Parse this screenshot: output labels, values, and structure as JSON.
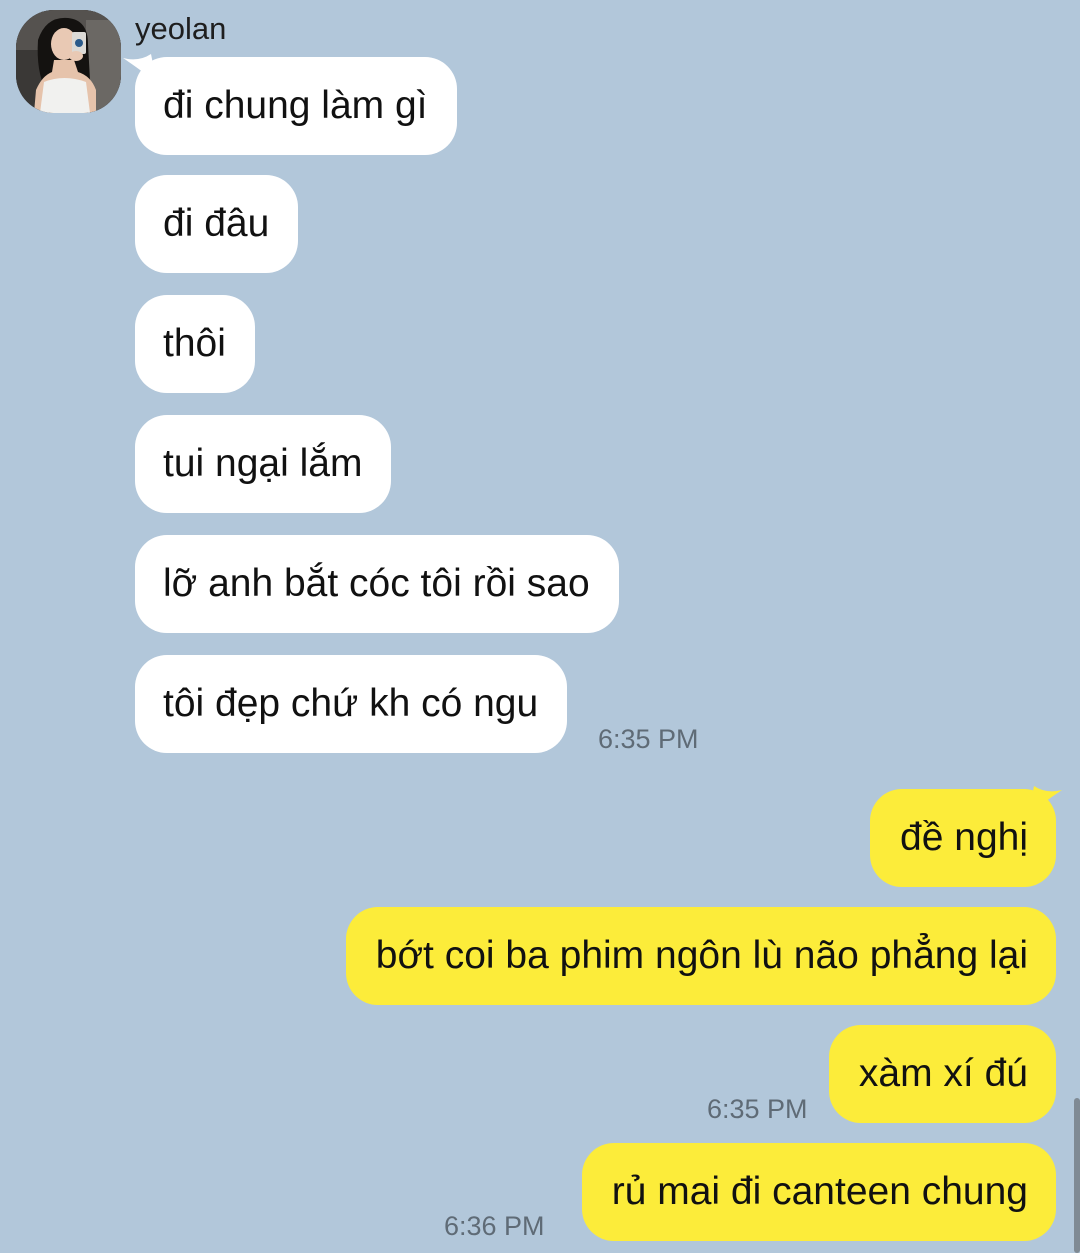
{
  "contact": {
    "name": "yeolan"
  },
  "incoming": [
    "đi chung làm gì",
    "đi đâu",
    "thôi",
    "tui ngại lắm",
    "lỡ anh bắt cóc tôi rồi sao",
    "tôi đẹp chứ kh có ngu"
  ],
  "incoming_time": "6:35 PM",
  "outgoing": [
    "đề nghị",
    "bớt coi ba phim ngôn lù não phẳng lại",
    "xàm xí đú",
    "rủ mai đi canteen chung"
  ],
  "outgoing_times": [
    "6:35 PM",
    "6:36 PM"
  ],
  "colors": {
    "background": "#b2c7da",
    "incoming_bubble": "#ffffff",
    "outgoing_bubble": "#fcec3a",
    "timestamp": "#5f6b76"
  }
}
